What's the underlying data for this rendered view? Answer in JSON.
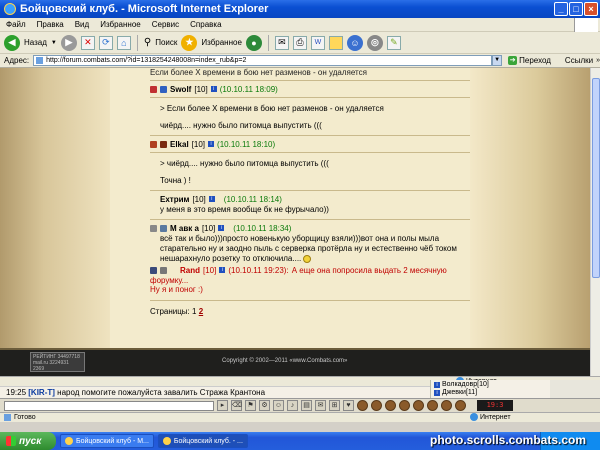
{
  "window": {
    "title": "Бойцовский клуб. - Microsoft Internet Explorer"
  },
  "menu": [
    "Файл",
    "Правка",
    "Вид",
    "Избранное",
    "Сервис",
    "Справка"
  ],
  "toolbar": {
    "back_label": "Назад",
    "search_label": "Поиск",
    "favorites_label": "Избранное"
  },
  "address": {
    "label": "Адрес:",
    "url": "http://forum.combats.com/?id=1318254248008n=index_rub&p=2",
    "go_label": "Переход",
    "links_label": "Ссылки"
  },
  "forum": {
    "top_text": "Если более Х времени в бою нет разменов - он удаляется",
    "posts": [
      {
        "user": "Swolf",
        "level": "[10]",
        "time": "(10.10.11 18:09)",
        "quote": "> Если более Х времени в бою нет разменов - он удаляется",
        "lines": [
          "чиёрд.... нужно было питомца выпустить ((("
        ]
      },
      {
        "user": "Elkal",
        "level": "[10]",
        "time": "(10.10.11 18:10)",
        "quote": "> чиёрд.... нужно было питомца выпустить (((",
        "lines": [
          "Точна ) !"
        ]
      },
      {
        "user": "Ехтрим",
        "level": "[10]",
        "time": "(10.10.11 18:14)",
        "quote": "",
        "lines": [
          "у меня в это время вообще бк не фурычало))"
        ]
      },
      {
        "user": "М авк а",
        "level": "[10]",
        "time": "(10.10.11 18:34)",
        "quote": "",
        "lines": [
          "всё так и было)))просто новенькую уборщицу взяли)))вот она и полы мыла",
          "старательно ну и заодно пыль с серверка протёрла ну и естественно чёб током",
          "нешарахнуло розетку то отключила.... "
        ]
      },
      {
        "user": "Rand",
        "level": "[10]",
        "time": "(10.10.11 19:23):",
        "quote": "А еще она попросила выдать 2 месячную",
        "lines": [
          "форумку...",
          "Ну я и поног :)"
        ]
      }
    ],
    "pages_label": "Страницы:",
    "page_1": "1",
    "page_2": "2",
    "counter_text": [
      "РЕЙТИНГ 34497718",
      "mail.ru 3224931",
      "2369"
    ],
    "copyright": "Copyright © 2002—2011 «www.Combats.com»"
  },
  "ie_status": {
    "zone": "Интернет"
  },
  "chat": {
    "time": "19:25",
    "nick": "[KIR-T]",
    "message": "народ помогите пожалуйста завалить Стража Крантона"
  },
  "players": [
    {
      "name": "Волкадовр",
      "level": "[10]"
    },
    {
      "name": "Джевки",
      "level": "[11]"
    }
  ],
  "game_clock": "19:3",
  "game_status": {
    "left": "Готово",
    "zone": "Интернет"
  },
  "taskbar": {
    "start": "пуск",
    "tasks": [
      "Бойцовский клуб - M...",
      "Бойцовский клуб. - ..."
    ]
  },
  "watermark": "photo.scrolls.combats.com",
  "colors": {
    "xp_blue": "#0a4fd2",
    "timestamp_green": "#0a7a0a",
    "rand_red": "#c00000",
    "parchment": "#f3ebcd"
  }
}
